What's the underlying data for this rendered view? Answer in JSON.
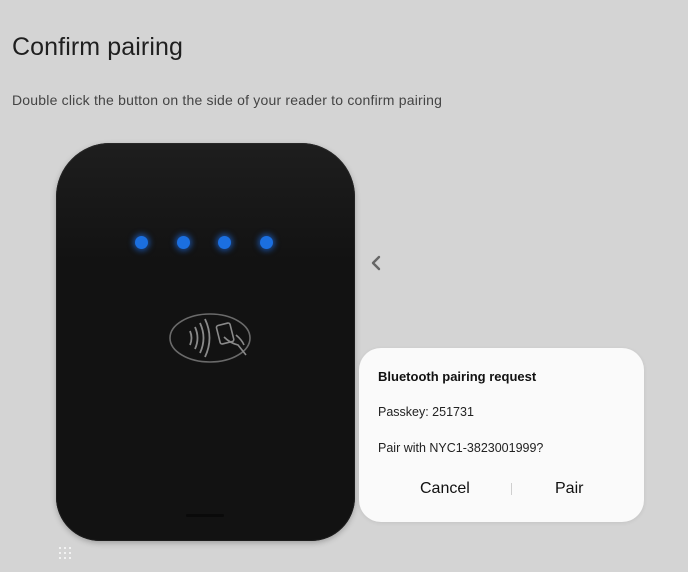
{
  "page": {
    "title": "Confirm pairing",
    "instructions": "Double click the button on the side of your reader to confirm pairing"
  },
  "reader": {
    "led_color": "#1b6fe0",
    "led_count": 4,
    "icons": [
      "contactless-icon",
      "card-icon"
    ]
  },
  "navigation": {
    "back_icon": "chevron-left-icon"
  },
  "dialog": {
    "title": "Bluetooth pairing request",
    "passkey": "Passkey: 251731",
    "question": "Pair with NYC1-3823001999?",
    "cancel_label": "Cancel",
    "pair_label": "Pair"
  },
  "handle": {
    "icon": "grid-dots-icon"
  }
}
